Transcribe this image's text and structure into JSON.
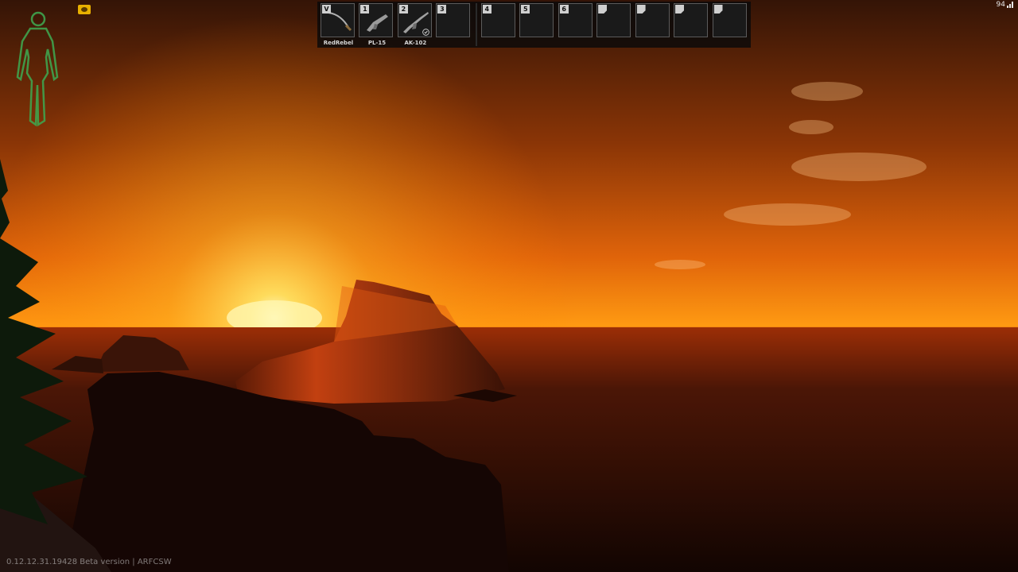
{
  "hotbar": {
    "slots": [
      {
        "key": "V",
        "name": "RedRebel",
        "icon": "ice-pick-icon",
        "has_item": true
      },
      {
        "key": "1",
        "name": "PL-15",
        "icon": "pistol-icon",
        "has_item": true
      },
      {
        "key": "2",
        "name": "AK-102",
        "icon": "rifle-icon",
        "has_item": true,
        "checked": true
      },
      {
        "key": "3",
        "name": "",
        "has_item": false
      },
      {
        "key": "4",
        "name": "",
        "has_item": false
      },
      {
        "key": "5",
        "name": "",
        "has_item": false
      },
      {
        "key": "6",
        "name": "",
        "has_item": false
      },
      {
        "key": "",
        "name": "",
        "has_item": false
      },
      {
        "key": "",
        "name": "",
        "has_item": false
      },
      {
        "key": "",
        "name": "",
        "has_item": false
      },
      {
        "key": "",
        "name": "",
        "has_item": false
      }
    ]
  },
  "fps": {
    "value": "94",
    "icon": "signal-icon"
  },
  "health_indicator": {
    "icon": "body-health-icon",
    "color": "#3fa34d"
  },
  "status_icon": {
    "icon": "eye-status-icon",
    "color": "#e8b000"
  },
  "footer": {
    "version": "0.12.12.31.19428 Beta version | ARFCSW"
  },
  "colors": {
    "sky_top": "#3b1a08",
    "sun": "#ffe066",
    "horizon": "#ff8c0f",
    "sea": "#1d0a04"
  }
}
